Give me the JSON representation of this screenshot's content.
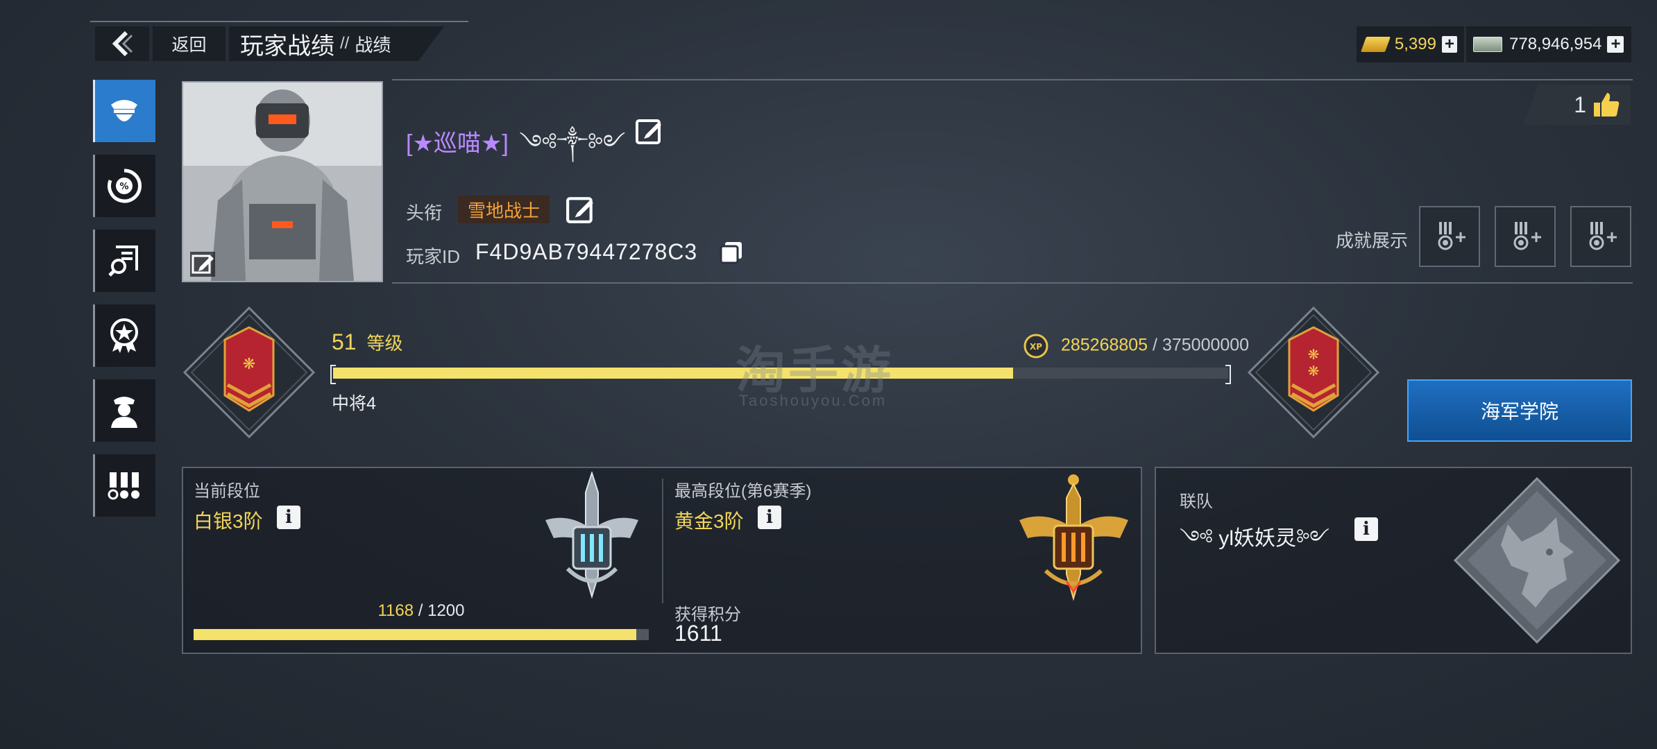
{
  "header": {
    "back_label": "返回",
    "title": "玩家战绩",
    "separator": "//",
    "subtitle": "战绩"
  },
  "currency": {
    "gold": "5,399",
    "cash": "778,946,954"
  },
  "sidebar": {
    "items": [
      {
        "icon": "officer-cap-icon",
        "active": true
      },
      {
        "icon": "percent-gauge-icon",
        "active": false
      },
      {
        "icon": "search-record-icon",
        "active": false
      },
      {
        "icon": "star-badge-icon",
        "active": false
      },
      {
        "icon": "officer-avatar-icon",
        "active": false
      },
      {
        "icon": "medal-ribbons-icon",
        "active": false
      }
    ]
  },
  "profile": {
    "name": "[★巡喵★]",
    "name_decoration": "༺༒༻",
    "title_label": "头衔",
    "title_value": "雪地战士",
    "id_label": "玩家ID",
    "id_value": "F4D9AB79447278C3",
    "likes": "1",
    "achievements_label": "成就展示"
  },
  "level": {
    "number": "51",
    "label": "等级",
    "xp_current": "285268805",
    "xp_sep": "/",
    "xp_total": "375000000",
    "xp_fraction": 0.76,
    "rank_name": "中将4",
    "navy_button": "海军学院"
  },
  "watermark": {
    "main": "淘手游",
    "sub": "Taoshouyou.Com"
  },
  "current_rank": {
    "label": "当前段位",
    "value": "白银3阶",
    "points_current": "1168",
    "points_sep": "/",
    "points_total": "1200",
    "points_fraction": 0.9733
  },
  "best_rank": {
    "label": "最高段位(第6赛季)",
    "value": "黄金3阶",
    "earned_label": "获得积分",
    "earned_value": "1611"
  },
  "team": {
    "label": "联队",
    "name": "༺ yl妖妖灵༻"
  },
  "colors": {
    "accent_blue": "#2b7ccc",
    "gold_text": "#f2d55a",
    "name_purple": "#b889ff",
    "title_orange": "#f3a23a",
    "bar_yellow": "#f4e26c"
  }
}
